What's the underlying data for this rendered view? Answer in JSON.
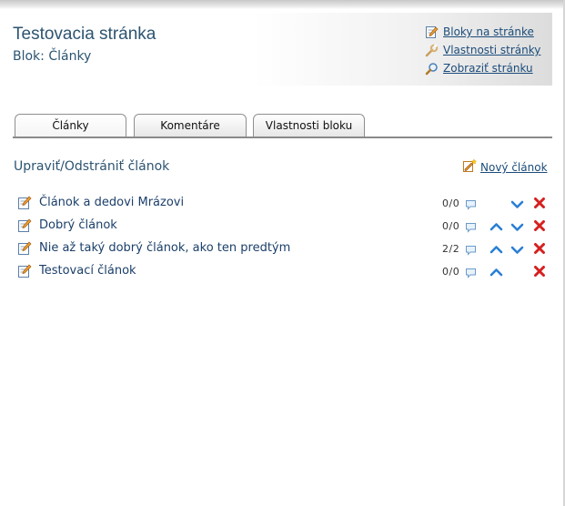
{
  "header": {
    "title": "Testovacia stránka",
    "subtitle": "Blok: Články",
    "links": [
      {
        "label": "Bloky na stránke",
        "icon": "edit-page-icon"
      },
      {
        "label": "Vlastnosti stránky",
        "icon": "wrench-icon"
      },
      {
        "label": "Zobraziť stránku",
        "icon": "magnifier-icon"
      }
    ]
  },
  "tabs": [
    {
      "label": "Články",
      "active": true
    },
    {
      "label": "Komentáre",
      "active": false
    },
    {
      "label": "Vlastnosti bloku",
      "active": false
    }
  ],
  "section": {
    "title": "Upraviť/Odstrániť článok",
    "new_label": "Nový článok"
  },
  "articles": [
    {
      "title": "Článok a dedovi Mrázovi",
      "comments": "0/0"
    },
    {
      "title": "Dobrý článok",
      "comments": "0/0"
    },
    {
      "title": "Nie až taký dobrý článok, ako ten predtým",
      "comments": "2/2"
    },
    {
      "title": "Testovací článok",
      "comments": "0/0"
    }
  ],
  "colors": {
    "accent": "#2c5471",
    "link": "#1b4c7a",
    "arrow": "#2a7fd4",
    "delete": "#d61f1f"
  }
}
